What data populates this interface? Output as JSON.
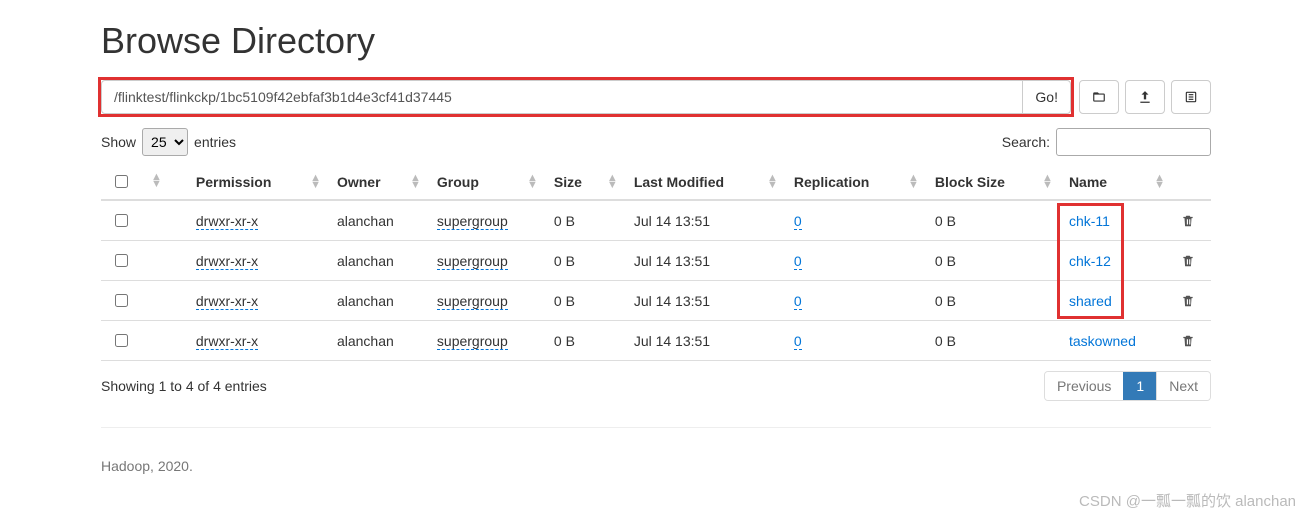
{
  "title": "Browse Directory",
  "path": "/flinktest/flinkckp/1bc5109f42ebfaf3b1d4e3cf41d37445",
  "goLabel": "Go!",
  "showLabelPrefix": "Show",
  "showLabelSuffix": "entries",
  "pageSize": "25",
  "searchLabel": "Search:",
  "searchValue": "",
  "columns": {
    "permission": "Permission",
    "owner": "Owner",
    "group": "Group",
    "size": "Size",
    "lastModified": "Last Modified",
    "replication": "Replication",
    "blockSize": "Block Size",
    "name": "Name"
  },
  "rows": [
    {
      "permission": "drwxr-xr-x",
      "owner": "alanchan",
      "group": "supergroup",
      "size": "0 B",
      "lastModified": "Jul 14 13:51",
      "replication": "0",
      "blockSize": "0 B",
      "name": "chk-11"
    },
    {
      "permission": "drwxr-xr-x",
      "owner": "alanchan",
      "group": "supergroup",
      "size": "0 B",
      "lastModified": "Jul 14 13:51",
      "replication": "0",
      "blockSize": "0 B",
      "name": "chk-12"
    },
    {
      "permission": "drwxr-xr-x",
      "owner": "alanchan",
      "group": "supergroup",
      "size": "0 B",
      "lastModified": "Jul 14 13:51",
      "replication": "0",
      "blockSize": "0 B",
      "name": "shared"
    },
    {
      "permission": "drwxr-xr-x",
      "owner": "alanchan",
      "group": "supergroup",
      "size": "0 B",
      "lastModified": "Jul 14 13:51",
      "replication": "0",
      "blockSize": "0 B",
      "name": "taskowned"
    }
  ],
  "summary": "Showing 1 to 4 of 4 entries",
  "pagination": {
    "previous": "Previous",
    "page": "1",
    "next": "Next"
  },
  "footer": "Hadoop, 2020.",
  "watermark": "CSDN @一瓢一瓢的饮 alanchan"
}
